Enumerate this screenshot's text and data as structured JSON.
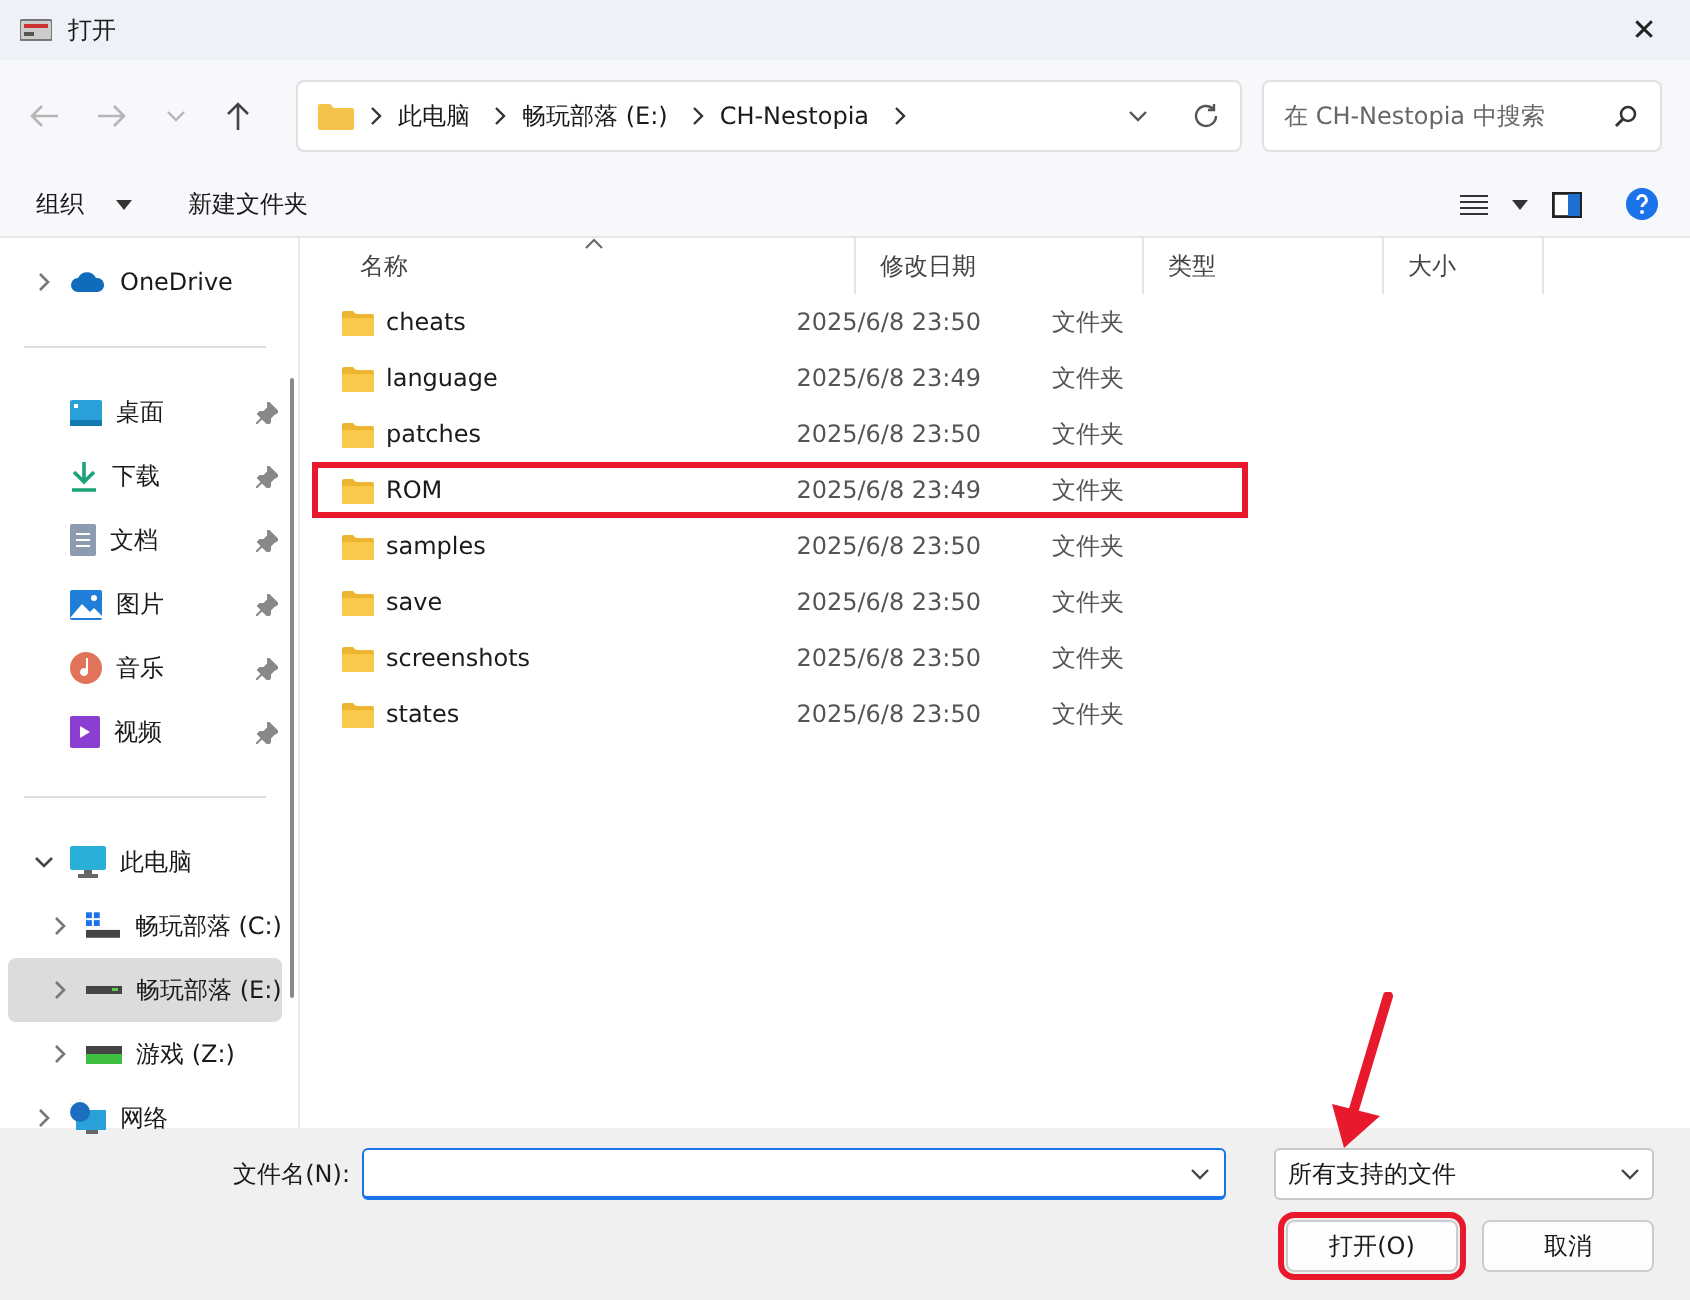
{
  "window": {
    "title": "打开",
    "close": "✕"
  },
  "address": {
    "path": [
      {
        "label": "此电脑"
      },
      {
        "label": "畅玩部落 (E:)"
      },
      {
        "label": "CH-Nestopia"
      }
    ],
    "search_placeholder": "在 CH-Nestopia 中搜索"
  },
  "toolbar": {
    "organize": "组织",
    "new_folder": "新建文件夹"
  },
  "sidebar": {
    "sections": [
      {
        "items": [
          {
            "label": "OneDrive",
            "kind": "cloud",
            "pinned": false,
            "expanded": false,
            "selected": false
          }
        ]
      },
      {
        "items": [
          {
            "label": "桌面",
            "kind": "desktop",
            "pinned": true,
            "selected": false
          },
          {
            "label": "下载",
            "kind": "download",
            "pinned": true,
            "selected": false
          },
          {
            "label": "文档",
            "kind": "document",
            "pinned": true,
            "selected": false
          },
          {
            "label": "图片",
            "kind": "picture",
            "pinned": true,
            "selected": false
          },
          {
            "label": "音乐",
            "kind": "music",
            "pinned": true,
            "selected": false
          },
          {
            "label": "视频",
            "kind": "video",
            "pinned": true,
            "selected": false
          }
        ]
      },
      {
        "items": [
          {
            "label": "此电脑",
            "kind": "computer",
            "pinned": false,
            "expanded": true,
            "selected": false,
            "children": [
              {
                "label": "畅玩部落 (C:)",
                "kind": "system-drive",
                "pinned": false,
                "expanded": false,
                "selected": false
              },
              {
                "label": "畅玩部落 (E:)",
                "kind": "drive",
                "pinned": false,
                "expanded": false,
                "selected": true
              },
              {
                "label": "游戏 (Z:)",
                "kind": "green-drive",
                "pinned": false,
                "expanded": false,
                "selected": false
              }
            ]
          },
          {
            "label": "网络",
            "kind": "network",
            "pinned": false,
            "expanded": false,
            "selected": false
          }
        ]
      }
    ]
  },
  "table": {
    "columns": [
      "名称",
      "修改日期",
      "类型",
      "大小"
    ],
    "rows": [
      {
        "name": "cheats",
        "date": "2025/6/8 23:50",
        "type": "文件夹",
        "highlighted": false
      },
      {
        "name": "language",
        "date": "2025/6/8 23:49",
        "type": "文件夹",
        "highlighted": false
      },
      {
        "name": "patches",
        "date": "2025/6/8 23:50",
        "type": "文件夹",
        "highlighted": false
      },
      {
        "name": "ROM",
        "date": "2025/6/8 23:49",
        "type": "文件夹",
        "highlighted": true
      },
      {
        "name": "samples",
        "date": "2025/6/8 23:50",
        "type": "文件夹",
        "highlighted": false
      },
      {
        "name": "save",
        "date": "2025/6/8 23:50",
        "type": "文件夹",
        "highlighted": false
      },
      {
        "name": "screenshots",
        "date": "2025/6/8 23:50",
        "type": "文件夹",
        "highlighted": false
      },
      {
        "name": "states",
        "date": "2025/6/8 23:50",
        "type": "文件夹",
        "highlighted": false
      }
    ]
  },
  "footer": {
    "filename_label": "文件名(N):",
    "filter": "所有支持的文件",
    "open": "打开(O)",
    "open_highlighted": true,
    "cancel": "取消"
  }
}
